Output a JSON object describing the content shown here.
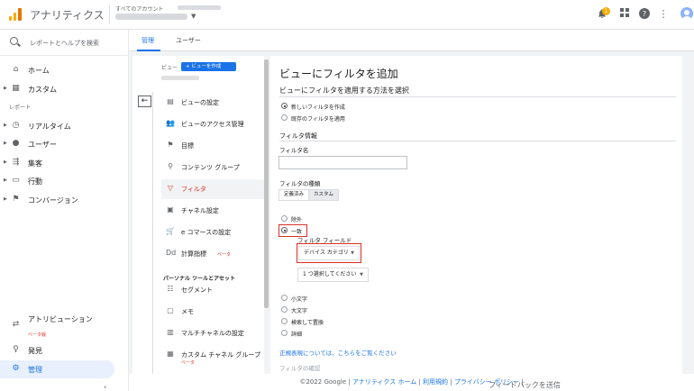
{
  "header": {
    "app_name": "アナリティクス",
    "account_label": "すべてのアカウント",
    "notification_count": "1",
    "icons": [
      "bell-icon",
      "apps-icon",
      "help-icon",
      "more-vert-icon",
      "avatar"
    ]
  },
  "sidebar": {
    "search_placeholder": "レポートとヘルプを検索",
    "items": [
      {
        "label": "ホーム",
        "icon": "home-icon"
      },
      {
        "label": "カスタム",
        "icon": "dashboard-icon"
      }
    ],
    "reports_section": "レポート",
    "report_items": [
      {
        "label": "リアルタイム",
        "icon": "clock-icon"
      },
      {
        "label": "ユーザー",
        "icon": "person-icon"
      },
      {
        "label": "集客",
        "icon": "acquisition-icon"
      },
      {
        "label": "行動",
        "icon": "behavior-icon"
      },
      {
        "label": "コンバージョン",
        "icon": "flag-icon"
      }
    ],
    "bottom_items": [
      {
        "label": "アトリビューション",
        "beta": "ベータ版",
        "icon": "attribution-icon"
      },
      {
        "label": "発見",
        "icon": "lightbulb-icon"
      },
      {
        "label": "管理",
        "icon": "gear-icon",
        "active": true
      }
    ],
    "collapse": "‹"
  },
  "tabs": [
    {
      "label": "管理",
      "selected": true
    },
    {
      "label": "ユーザー",
      "selected": false
    }
  ],
  "admin": {
    "view_label": "ビュー",
    "create_view_button": "+ ビューを作成",
    "items": [
      {
        "label": "ビューの設定",
        "icon": "document-icon"
      },
      {
        "label": "ビューのアクセス管理",
        "icon": "people-icon"
      },
      {
        "label": "目標",
        "icon": "flag-icon"
      },
      {
        "label": "コンテンツ グループ",
        "icon": "content-group-icon"
      },
      {
        "label": "フィルタ",
        "icon": "filter-icon",
        "selected": true
      },
      {
        "label": "チャネル設定",
        "icon": "channel-icon"
      },
      {
        "label": "e コマースの設定",
        "icon": "cart-icon"
      },
      {
        "label": "計算指標",
        "beta": "ベータ",
        "icon": "calc-icon"
      }
    ],
    "personal_section": "パーソナル ツールとアセット",
    "personal_items": [
      {
        "label": "セグメント",
        "icon": "segment-icon"
      },
      {
        "label": "メモ",
        "icon": "note-icon"
      },
      {
        "label": "マルチチャネルの設定",
        "icon": "bar-chart-icon"
      },
      {
        "label": "カスタム チャネル グループ",
        "beta": "ベータ",
        "icon": "custom-channel-icon"
      }
    ]
  },
  "panel": {
    "title": "ビューにフィルタを追加",
    "method_heading": "ビューにフィルタを適用する方法を選択",
    "method_options": [
      {
        "label": "新しいフィルタを作成",
        "checked": true
      },
      {
        "label": "既存のフィルタを適用",
        "checked": false
      }
    ],
    "info_heading": "フィルタ情報",
    "name_label": "フィルタ名",
    "name_value": "",
    "type_label": "フィルタの種類",
    "type_segments": [
      "定義済み",
      "カスタム"
    ],
    "type_options": [
      {
        "label": "除外",
        "checked": false
      },
      {
        "label": "一致",
        "checked": true
      }
    ],
    "field_label": "フィルタ フィールド",
    "field_value": "デバイス カテゴリ",
    "select_value": "1 つ選択してください",
    "other_options": [
      {
        "label": "小文字"
      },
      {
        "label": "大文字"
      },
      {
        "label": "検索して置換"
      },
      {
        "label": "詳細"
      }
    ],
    "help_link": "正規表現については、こちらをご覧ください",
    "cutoff_text": "フィルタの確認"
  },
  "footer": {
    "copyright": "©2022 Google",
    "links": [
      "アナリティクス ホーム",
      "利用規約",
      "プライバシー ポリシー"
    ],
    "feedback": "フィードバックを送信"
  },
  "colors": {
    "accent": "#1a73e8",
    "highlight": "#d93025",
    "logo": "#f9ab00"
  }
}
